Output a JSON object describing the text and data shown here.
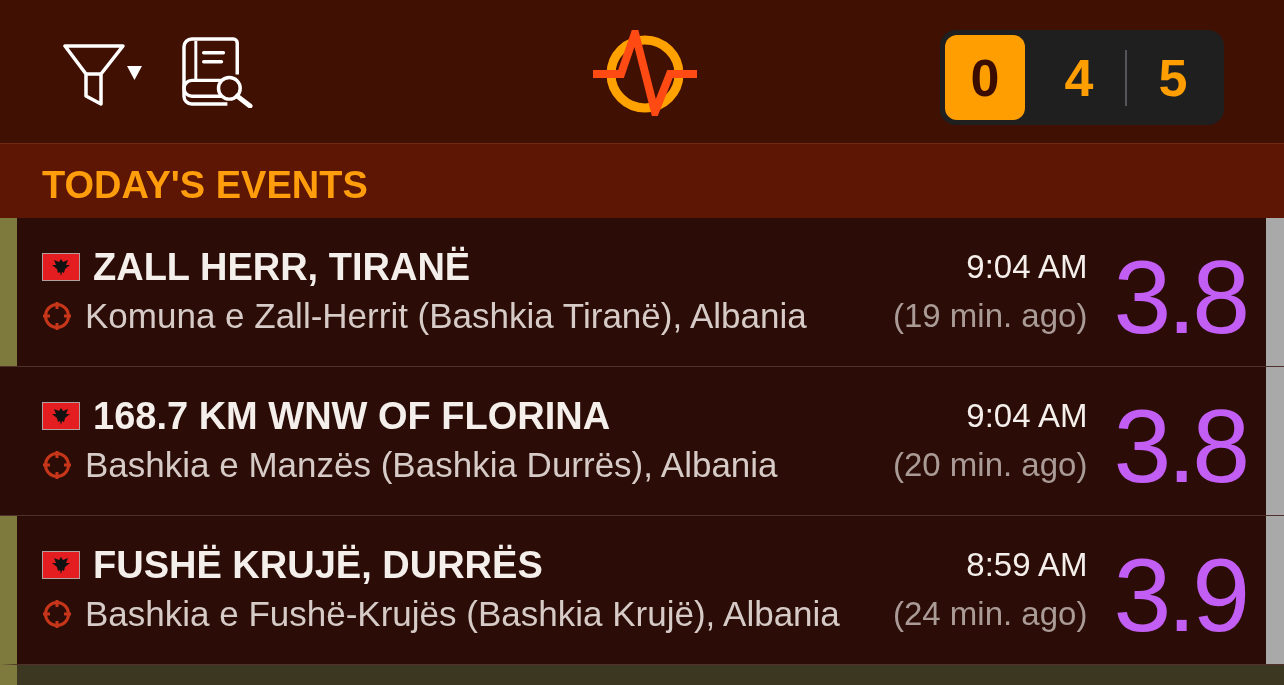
{
  "toolbar": {
    "counter": [
      {
        "label": "0",
        "selected": true
      },
      {
        "label": "4",
        "selected": false
      },
      {
        "label": "5",
        "selected": false
      }
    ]
  },
  "section": {
    "title": "TODAY'S EVENTS"
  },
  "events": [
    {
      "highlighted": true,
      "title": "ZALL HERR, TIRANË",
      "location": "Komuna e Zall-Herrit (Bashkia Tiranë), Albania",
      "time": "9:04 AM",
      "ago": "(19 min. ago)",
      "magnitude": "3.8"
    },
    {
      "highlighted": false,
      "title": "168.7 KM WNW OF FLORINA",
      "location": "Bashkia e Manzës (Bashkia Durrës), Albania",
      "time": "9:04 AM",
      "ago": "(20 min. ago)",
      "magnitude": "3.8"
    },
    {
      "highlighted": true,
      "title": "FUSHË KRUJË, DURRËS",
      "location": "Bashkia e Fushë-Krujës (Bashkia Krujë), Albania",
      "time": "8:59 AM",
      "ago": "(24 min. ago)",
      "magnitude": "3.9"
    }
  ]
}
